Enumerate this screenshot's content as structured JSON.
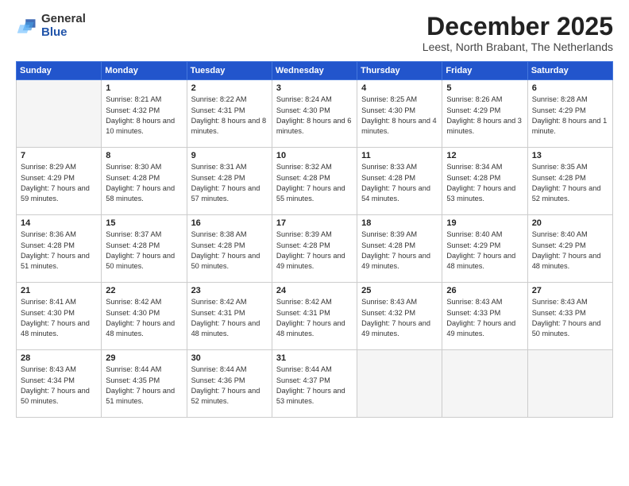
{
  "header": {
    "logo_general": "General",
    "logo_blue": "Blue",
    "month_title": "December 2025",
    "location": "Leest, North Brabant, The Netherlands"
  },
  "weekdays": [
    "Sunday",
    "Monday",
    "Tuesday",
    "Wednesday",
    "Thursday",
    "Friday",
    "Saturday"
  ],
  "weeks": [
    [
      {
        "day": "",
        "empty": true
      },
      {
        "day": "1",
        "sunrise": "8:21 AM",
        "sunset": "4:32 PM",
        "daylight": "8 hours and 10 minutes."
      },
      {
        "day": "2",
        "sunrise": "8:22 AM",
        "sunset": "4:31 PM",
        "daylight": "8 hours and 8 minutes."
      },
      {
        "day": "3",
        "sunrise": "8:24 AM",
        "sunset": "4:30 PM",
        "daylight": "8 hours and 6 minutes."
      },
      {
        "day": "4",
        "sunrise": "8:25 AM",
        "sunset": "4:30 PM",
        "daylight": "8 hours and 4 minutes."
      },
      {
        "day": "5",
        "sunrise": "8:26 AM",
        "sunset": "4:29 PM",
        "daylight": "8 hours and 3 minutes."
      },
      {
        "day": "6",
        "sunrise": "8:28 AM",
        "sunset": "4:29 PM",
        "daylight": "8 hours and 1 minute."
      }
    ],
    [
      {
        "day": "7",
        "sunrise": "8:29 AM",
        "sunset": "4:29 PM",
        "daylight": "7 hours and 59 minutes."
      },
      {
        "day": "8",
        "sunrise": "8:30 AM",
        "sunset": "4:28 PM",
        "daylight": "7 hours and 58 minutes."
      },
      {
        "day": "9",
        "sunrise": "8:31 AM",
        "sunset": "4:28 PM",
        "daylight": "7 hours and 57 minutes."
      },
      {
        "day": "10",
        "sunrise": "8:32 AM",
        "sunset": "4:28 PM",
        "daylight": "7 hours and 55 minutes."
      },
      {
        "day": "11",
        "sunrise": "8:33 AM",
        "sunset": "4:28 PM",
        "daylight": "7 hours and 54 minutes."
      },
      {
        "day": "12",
        "sunrise": "8:34 AM",
        "sunset": "4:28 PM",
        "daylight": "7 hours and 53 minutes."
      },
      {
        "day": "13",
        "sunrise": "8:35 AM",
        "sunset": "4:28 PM",
        "daylight": "7 hours and 52 minutes."
      }
    ],
    [
      {
        "day": "14",
        "sunrise": "8:36 AM",
        "sunset": "4:28 PM",
        "daylight": "7 hours and 51 minutes."
      },
      {
        "day": "15",
        "sunrise": "8:37 AM",
        "sunset": "4:28 PM",
        "daylight": "7 hours and 50 minutes."
      },
      {
        "day": "16",
        "sunrise": "8:38 AM",
        "sunset": "4:28 PM",
        "daylight": "7 hours and 50 minutes."
      },
      {
        "day": "17",
        "sunrise": "8:39 AM",
        "sunset": "4:28 PM",
        "daylight": "7 hours and 49 minutes."
      },
      {
        "day": "18",
        "sunrise": "8:39 AM",
        "sunset": "4:28 PM",
        "daylight": "7 hours and 49 minutes."
      },
      {
        "day": "19",
        "sunrise": "8:40 AM",
        "sunset": "4:29 PM",
        "daylight": "7 hours and 48 minutes."
      },
      {
        "day": "20",
        "sunrise": "8:40 AM",
        "sunset": "4:29 PM",
        "daylight": "7 hours and 48 minutes."
      }
    ],
    [
      {
        "day": "21",
        "sunrise": "8:41 AM",
        "sunset": "4:30 PM",
        "daylight": "7 hours and 48 minutes."
      },
      {
        "day": "22",
        "sunrise": "8:42 AM",
        "sunset": "4:30 PM",
        "daylight": "7 hours and 48 minutes."
      },
      {
        "day": "23",
        "sunrise": "8:42 AM",
        "sunset": "4:31 PM",
        "daylight": "7 hours and 48 minutes."
      },
      {
        "day": "24",
        "sunrise": "8:42 AM",
        "sunset": "4:31 PM",
        "daylight": "7 hours and 48 minutes."
      },
      {
        "day": "25",
        "sunrise": "8:43 AM",
        "sunset": "4:32 PM",
        "daylight": "7 hours and 49 minutes."
      },
      {
        "day": "26",
        "sunrise": "8:43 AM",
        "sunset": "4:33 PM",
        "daylight": "7 hours and 49 minutes."
      },
      {
        "day": "27",
        "sunrise": "8:43 AM",
        "sunset": "4:33 PM",
        "daylight": "7 hours and 50 minutes."
      }
    ],
    [
      {
        "day": "28",
        "sunrise": "8:43 AM",
        "sunset": "4:34 PM",
        "daylight": "7 hours and 50 minutes."
      },
      {
        "day": "29",
        "sunrise": "8:44 AM",
        "sunset": "4:35 PM",
        "daylight": "7 hours and 51 minutes."
      },
      {
        "day": "30",
        "sunrise": "8:44 AM",
        "sunset": "4:36 PM",
        "daylight": "7 hours and 52 minutes."
      },
      {
        "day": "31",
        "sunrise": "8:44 AM",
        "sunset": "4:37 PM",
        "daylight": "7 hours and 53 minutes."
      },
      {
        "day": "",
        "empty": true
      },
      {
        "day": "",
        "empty": true
      },
      {
        "day": "",
        "empty": true
      }
    ]
  ]
}
